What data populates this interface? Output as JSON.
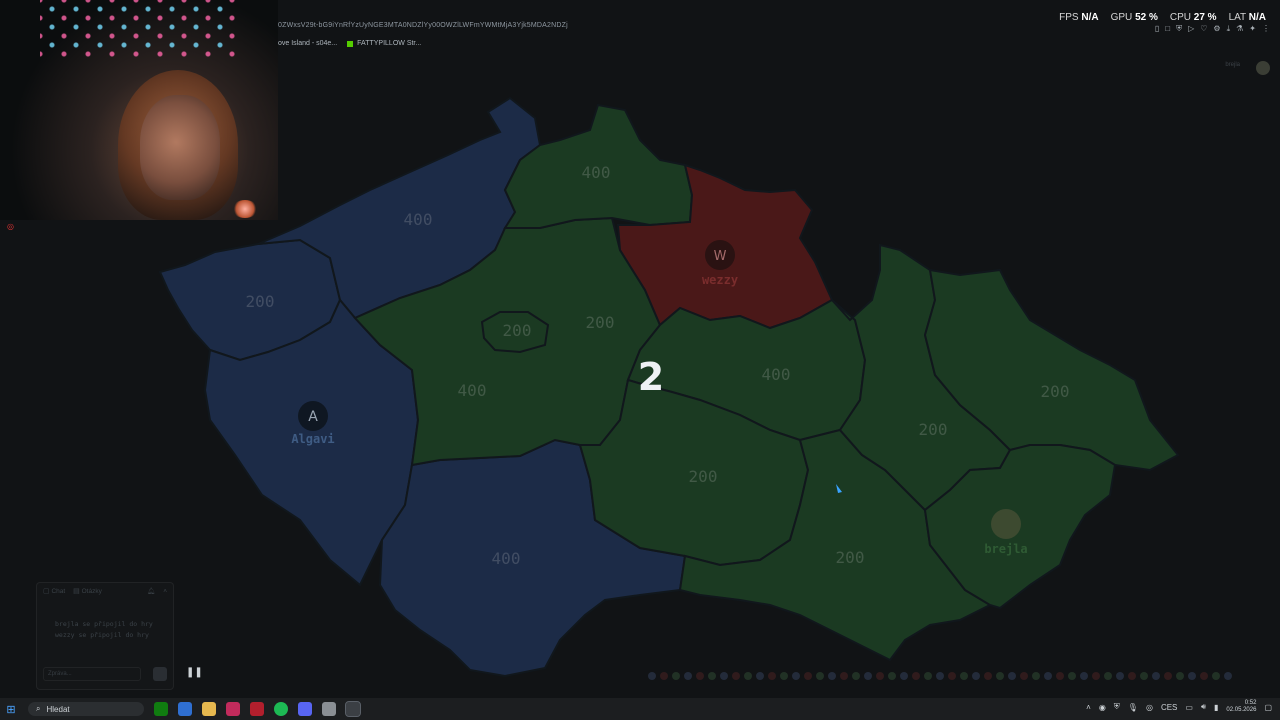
{
  "window": {
    "url_text": "0ZWxsV29t-bG9iYnRfYzUyNGE3MTA0NDZlYy00OWZlLWFmYWMtMjA3Yjk5MDA2NDZj",
    "tabs": [
      {
        "label": "ove Island - s04e..."
      },
      {
        "label": "FATTYPILLOW Str..."
      }
    ]
  },
  "perf": {
    "fps_label": "FPS",
    "fps_value": "N/A",
    "gpu_label": "GPU",
    "gpu_value": "52 %",
    "cpu_label": "CPU",
    "cpu_value": "27 %",
    "lat_label": "LAT",
    "lat_value": "N/A"
  },
  "ghost_menu": {
    "profile_name": "brejla"
  },
  "map": {
    "center_number": "2",
    "colors": {
      "blue": "#1c2b47",
      "green": "#1b3a22",
      "red": "#4a1818",
      "border": "#11171c"
    },
    "regions": [
      {
        "id": "praha",
        "value": "200"
      },
      {
        "id": "stredocesky",
        "value": "200"
      },
      {
        "id": "jihocesky",
        "value": "400"
      },
      {
        "id": "plzensky",
        "value": "200"
      },
      {
        "id": "karlovarsky",
        "value": "200"
      },
      {
        "id": "ustecky",
        "value": "400"
      },
      {
        "id": "liberecky",
        "value": "400"
      },
      {
        "id": "kralovehradecky",
        "value": "200"
      },
      {
        "id": "pardubicky",
        "value": "400"
      },
      {
        "id": "vysocina",
        "value": "400"
      },
      {
        "id": "jihomoravsky",
        "value": "200"
      },
      {
        "id": "olomoucky",
        "value": "200"
      },
      {
        "id": "moravskoslezsky",
        "value": "200"
      },
      {
        "id": "zlinsky",
        "value": "200"
      }
    ],
    "players": [
      {
        "name": "Algavi",
        "initial": "A",
        "color": "#3f5c84"
      },
      {
        "name": "wezzy",
        "initial": "W",
        "color": "#7a2d2d"
      },
      {
        "name": "brejla",
        "initial": "",
        "color": "#2f5b34"
      }
    ]
  },
  "chat": {
    "tab_chat": "Chat",
    "tab_otazky": "Otázky",
    "messages": [
      "brejla se připojil do hry",
      "wezzy se připojil do hry"
    ],
    "input_placeholder": "Zpráva..."
  },
  "taskbar": {
    "search_placeholder": "Hledat",
    "lang": "CES",
    "time": "0:52",
    "date": "02.05.2026"
  }
}
